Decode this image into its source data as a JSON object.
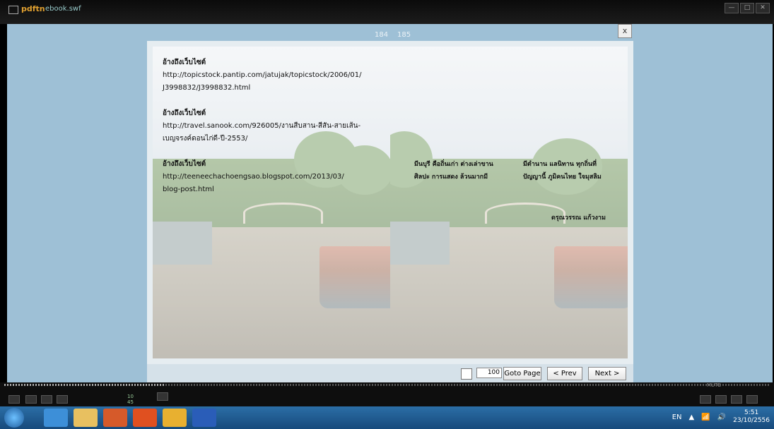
{
  "titlebar": {
    "brand": "pdftn",
    "filename": "ebook.swf",
    "buttons": [
      "—",
      "□",
      "✕"
    ]
  },
  "viewer": {
    "page_left_num": "184",
    "page_right_num": "185",
    "close_label": "x",
    "left_page": {
      "lines": [
        {
          "text": "อ้างถึงเว็บไซต์",
          "bold": true
        },
        {
          "text": "http://topicstock.pantip.com/jatujak/topicstock/2006/01/",
          "bold": false
        },
        {
          "text": "J3998832/J3998832.html",
          "bold": false
        },
        {
          "text": "",
          "bold": false
        },
        {
          "text": "อ้างถึงเว็บไซต์",
          "bold": true
        },
        {
          "text": "http://travel.sanook.com/926005/งานสืบสาน-สีสัน-สายเส้น-",
          "bold": false
        },
        {
          "text": "เบญจรงค์ดอนไก่ดี-ปี-2553/",
          "bold": false
        },
        {
          "text": "",
          "bold": false
        },
        {
          "text": "อ้างถึงเว็บไซต์",
          "bold": true
        },
        {
          "text": "http://teeneechachoengsao.blogspot.com/2013/03/",
          "bold": false
        },
        {
          "text": "blog-post.html",
          "bold": false
        }
      ]
    },
    "right_page": {
      "poem_left": [
        "มีนบุรี คือถิ่นเก่า ต่างเล่าขาน",
        "ศิลปะ การแสดง ล้วนมากมี"
      ],
      "poem_right": [
        "มีตำนาน แลนิทาน ทุกถิ่นที่",
        "ปัญญานี้ ภูมิคนไทย ใจมุสลิม"
      ],
      "author": "ดรุณวรรณ แก้วงาม"
    },
    "nav": {
      "page_input": "100",
      "goto_label": "Goto Page",
      "prev_label": "< Prev",
      "next_label": "Next >"
    }
  },
  "player": {
    "mute_label": "MUTE",
    "counter_top": "10",
    "counter_bottom": "45"
  },
  "taskbar": {
    "lang": "EN",
    "time": "5:51",
    "date": "23/10/2556"
  }
}
